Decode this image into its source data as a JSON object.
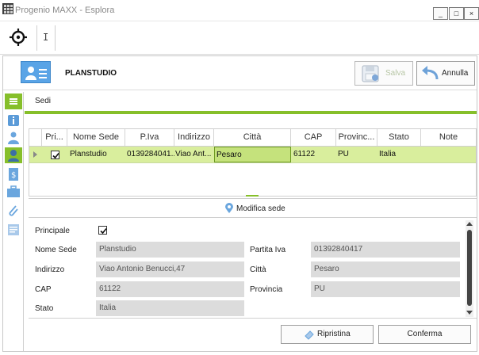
{
  "window": {
    "title": "Progenio MAXX - Esplora",
    "minimize": "_",
    "maximize": "□",
    "close": "×"
  },
  "toolbar": {
    "cursor_glyph": "I"
  },
  "header": {
    "title": "PLANSTUDIO",
    "save_label": "Salva",
    "cancel_label": "Annulla"
  },
  "section": {
    "title": "Sedi"
  },
  "grid": {
    "columns": [
      "Pri...",
      "Nome Sede",
      "P.Iva",
      "Indirizzo",
      "Città",
      "CAP",
      "Provinc...",
      "Stato",
      "Note"
    ],
    "rows": [
      {
        "principale": true,
        "nome_sede": "Planstudio",
        "piva": "0139284041...",
        "indirizzo": "Viao Ant...",
        "citta": "Pesaro",
        "cap": "61122",
        "provincia": "PU",
        "stato": "Italia",
        "note": ""
      }
    ]
  },
  "modifica": {
    "label": "Modifica sede"
  },
  "form": {
    "principale_label": "Principale",
    "principale_checked": true,
    "nome_sede_label": "Nome Sede",
    "nome_sede_value": "Planstudio",
    "partita_iva_label": "Partita Iva",
    "partita_iva_value": "01392840417",
    "indirizzo_label": "Indirizzo",
    "indirizzo_value": "Viao Antonio Benucci,47",
    "citta_label": "Città",
    "citta_value": "Pesaro",
    "cap_label": "CAP",
    "cap_value": "61122",
    "provincia_label": "Provincia",
    "provincia_value": "PU",
    "stato_label": "Stato",
    "stato_value": "Italia"
  },
  "footer": {
    "ripristina_label": "Ripristina",
    "conferma_label": "Conferma"
  },
  "sidebar": {
    "items": [
      "menu-icon",
      "info-icon",
      "contact-icon",
      "user-sede-icon",
      "document-dollar-icon",
      "briefcase-icon",
      "paperclip-icon",
      "notes-icon"
    ]
  },
  "colors": {
    "accent_green": "#86bf2a",
    "row_selected": "#d9ee9d",
    "header_icon_blue": "#5aa4e6"
  }
}
